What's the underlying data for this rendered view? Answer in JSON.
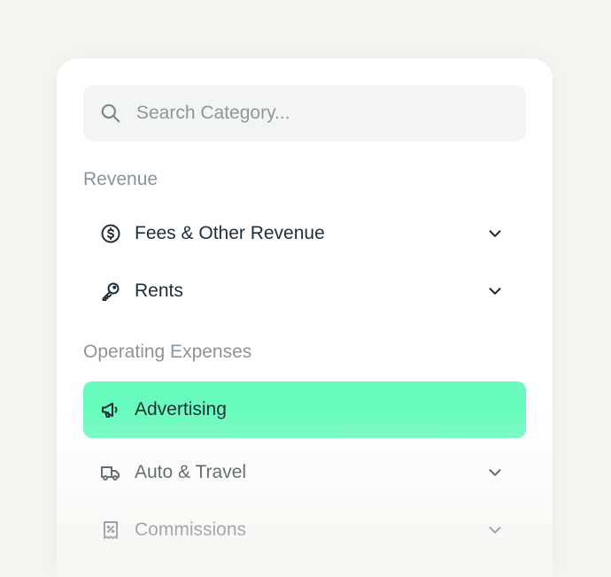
{
  "search": {
    "placeholder": "Search Category..."
  },
  "sections": [
    {
      "label": "Revenue"
    },
    {
      "label": "Operating Expenses"
    }
  ],
  "items": [
    {
      "label": "Fees & Other Revenue",
      "icon": "dollar-circle-icon",
      "expandable": true
    },
    {
      "label": "Rents",
      "icon": "key-icon",
      "expandable": true
    },
    {
      "label": "Advertising",
      "icon": "megaphone-icon",
      "expandable": false,
      "selected": true
    },
    {
      "label": "Auto & Travel",
      "icon": "truck-icon",
      "expandable": true
    },
    {
      "label": "Commissions",
      "icon": "receipt-percent-icon",
      "expandable": true
    }
  ],
  "colors": {
    "accent": "#68fbbd",
    "text": "#1f2d3a",
    "muted": "#8a949c",
    "background": "#f4f4f0"
  }
}
